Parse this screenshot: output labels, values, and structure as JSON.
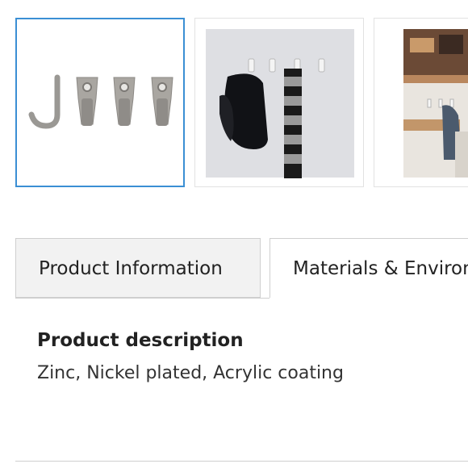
{
  "gallery": {
    "thumbnails": [
      {
        "icon": "hooks-product-image",
        "selected": true
      },
      {
        "icon": "hooks-with-cap-scarf-image",
        "selected": false
      },
      {
        "icon": "cafe-wall-hooks-image",
        "selected": false
      }
    ]
  },
  "tabs": [
    {
      "label": "Product Information",
      "active": false
    },
    {
      "label": "Materials & Environment",
      "active": true
    }
  ],
  "product": {
    "description_heading": "Product description",
    "description_text": "Zinc, Nickel plated, Acrylic coating"
  },
  "colors": {
    "selected_border": "#3b8fd4",
    "tab_inactive_bg": "#f2f2f2",
    "border": "#cfcfcf"
  }
}
